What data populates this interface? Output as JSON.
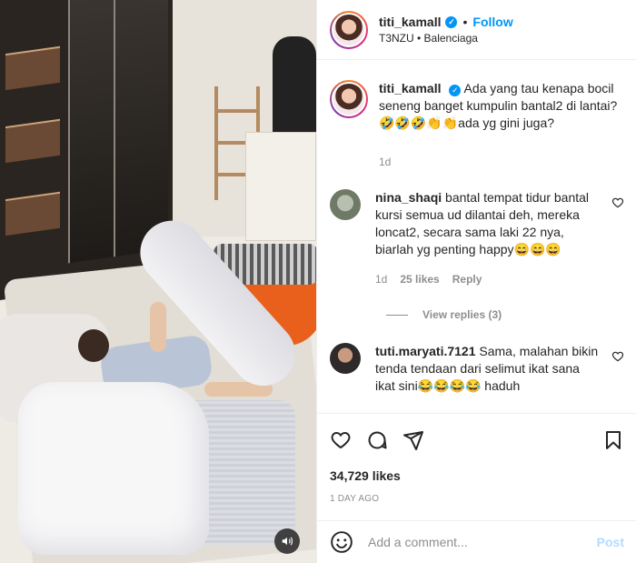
{
  "post": {
    "author": {
      "username": "titi_kamall",
      "verified": true,
      "follow_label": "Follow",
      "location": "T3NZU • Balenciaga"
    },
    "caption": {
      "username": "titi_kamall",
      "text": "Ada yang tau kenapa bocil seneng banget kumpulin bantal2 di lantai? 🤣🤣🤣👏👏ada yg gini juga?",
      "age": "1d"
    },
    "comments": [
      {
        "username": "nina_shaqi",
        "text": "bantal tempat tidur bantal kursi semua ud dilantai deh, mereka loncat2, secara sama laki 22 nya, biarlah yg penting happy😄😄😄",
        "age": "1d",
        "likes": "25 likes",
        "reply_label": "Reply",
        "view_replies": "View replies (3)"
      },
      {
        "username": "tuti.maryati.7121",
        "text": "Sama, malahan bikin tenda tendaan dari selimut ikat sana ikat sini😂😂😂😂 haduh"
      }
    ],
    "likes": "34,729 likes",
    "date": "1 DAY AGO",
    "comment_box": {
      "placeholder": "Add a comment...",
      "post_label": "Post"
    }
  },
  "icons": [
    "emoji-icon",
    "heart-icon",
    "comment-icon",
    "share-icon",
    "bookmark-icon",
    "sound-icon"
  ],
  "colors": {
    "accent": "#0095f6",
    "muted": "#8e8e8e",
    "post_disabled": "#b3dbff",
    "text": "#262626"
  }
}
